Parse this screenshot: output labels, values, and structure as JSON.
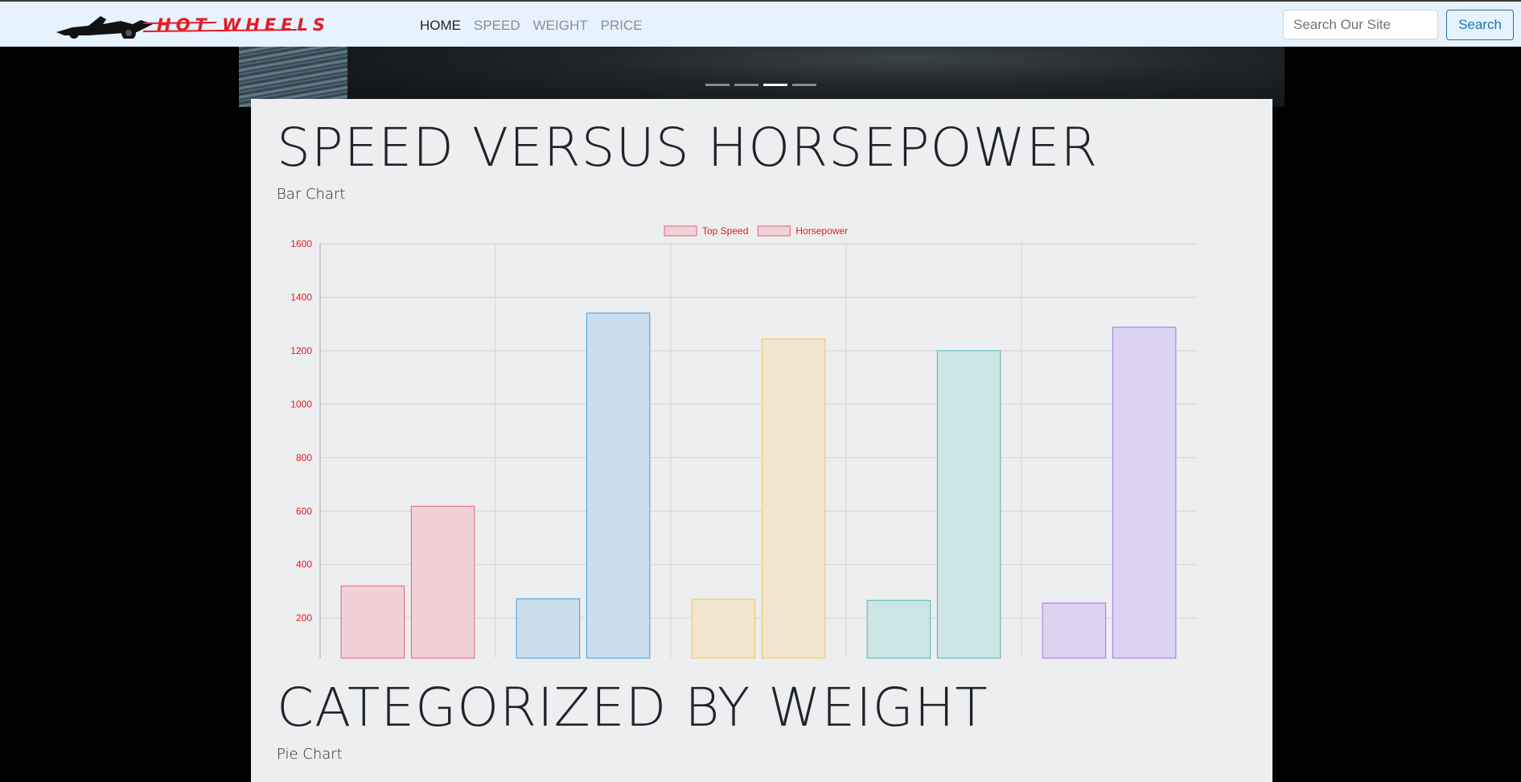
{
  "brand": {
    "logo_text": "HOT WHEELS"
  },
  "nav": {
    "links": [
      {
        "label": "HOME",
        "active": true
      },
      {
        "label": "SPEED",
        "active": false
      },
      {
        "label": "WEIGHT",
        "active": false
      },
      {
        "label": "PRICE",
        "active": false
      }
    ]
  },
  "search": {
    "placeholder": "Search Our Site",
    "button_label": "Search"
  },
  "carousel": {
    "slides": 4,
    "active_index": 2
  },
  "sections": {
    "speed": {
      "title": "SPEED VERSUS HORSEPOWER",
      "subtitle": "Bar Chart"
    },
    "weight": {
      "title": "CATEGORIZED BY WEIGHT",
      "subtitle": "Pie Chart"
    }
  },
  "colors": {
    "accent": "#1a73b8",
    "chart_text": "#e41b23"
  },
  "chart_data": {
    "type": "bar",
    "categories": [
      "",
      "",
      "",
      "",
      ""
    ],
    "series": [
      {
        "name": "Top Speed",
        "values": [
          320,
          272,
          270,
          266,
          256
        ]
      },
      {
        "name": "Horsepower",
        "values": [
          618,
          1341,
          1244,
          1200,
          1288
        ]
      }
    ],
    "bar_colors": [
      {
        "fill": "#f1d1d8",
        "stroke": "#e8607a"
      },
      {
        "fill": "#cbdeed",
        "stroke": "#3d9ee0"
      },
      {
        "fill": "#f1e6cd",
        "stroke": "#f3c65a"
      },
      {
        "fill": "#cce5e5",
        "stroke": "#4fb7b7"
      },
      {
        "fill": "#dcd3f0",
        "stroke": "#a070f5"
      }
    ],
    "legend_color": {
      "fill": "#f1d1d8",
      "stroke": "#e8607a"
    },
    "yticks": [
      200,
      400,
      600,
      800,
      1000,
      1200,
      1400,
      1600
    ],
    "ylim": [
      50,
      1600
    ],
    "grid": true,
    "legend_position": "top"
  }
}
